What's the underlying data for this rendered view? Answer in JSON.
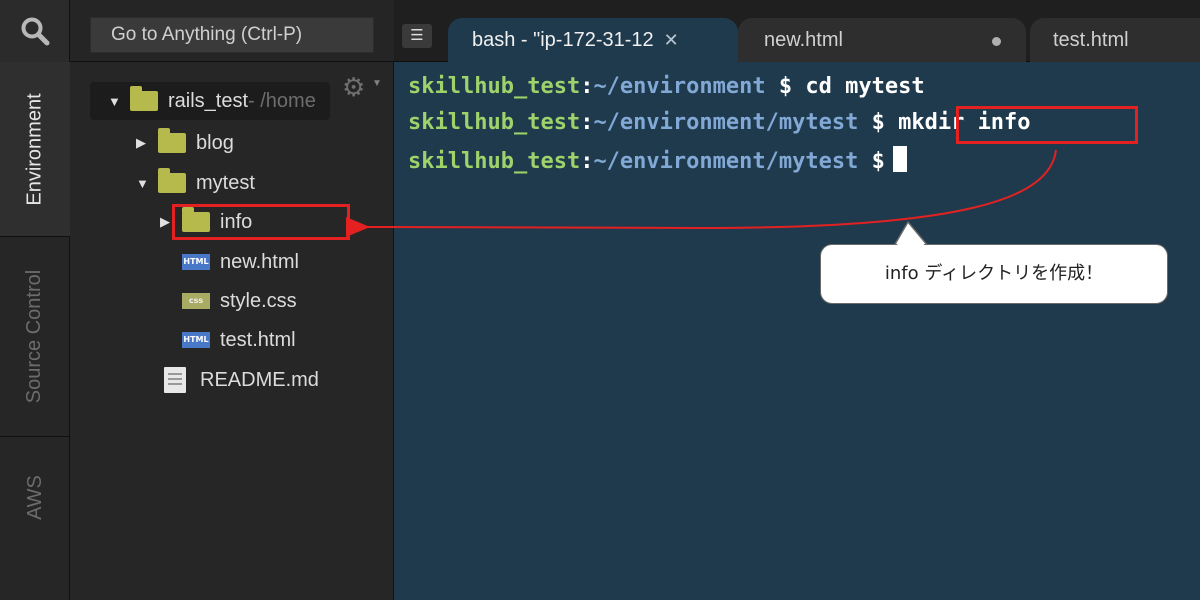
{
  "goto": {
    "label": "Go to Anything (Ctrl-P)"
  },
  "side_tabs": [
    "Environment",
    "Source Control",
    "AWS"
  ],
  "tree": {
    "root_name": "rails_test",
    "root_path": " - /home",
    "blog": "blog",
    "mytest": "mytest",
    "info": "info",
    "new_html": "new.html",
    "style_css": "style.css",
    "test_html": "test.html",
    "readme": "README.md",
    "badges": {
      "html": "HTML",
      "css": "css"
    }
  },
  "tabs": {
    "bash": "bash - \"ip-172-31-12",
    "new": "new.html",
    "test": "test.html"
  },
  "terminal": {
    "user": "skillhub_test",
    "colon": ":",
    "line1_path": "~/environment",
    "line1_cmd": " $ cd mytest",
    "line2_path": "~/environment/mytest",
    "line2_prompt": " $ ",
    "line2_cmd": "mkdir info",
    "line3_path": "~/environment/mytest",
    "line3_prompt": " $"
  },
  "annotation": {
    "text": "info ディレクトリを作成！"
  },
  "colors": {
    "terminal_bg": "#1f3a4d",
    "user_green": "#9ed36c",
    "path_blue": "#82a9d6",
    "highlight_red": "#e32121",
    "folder": "#b6b94b"
  }
}
